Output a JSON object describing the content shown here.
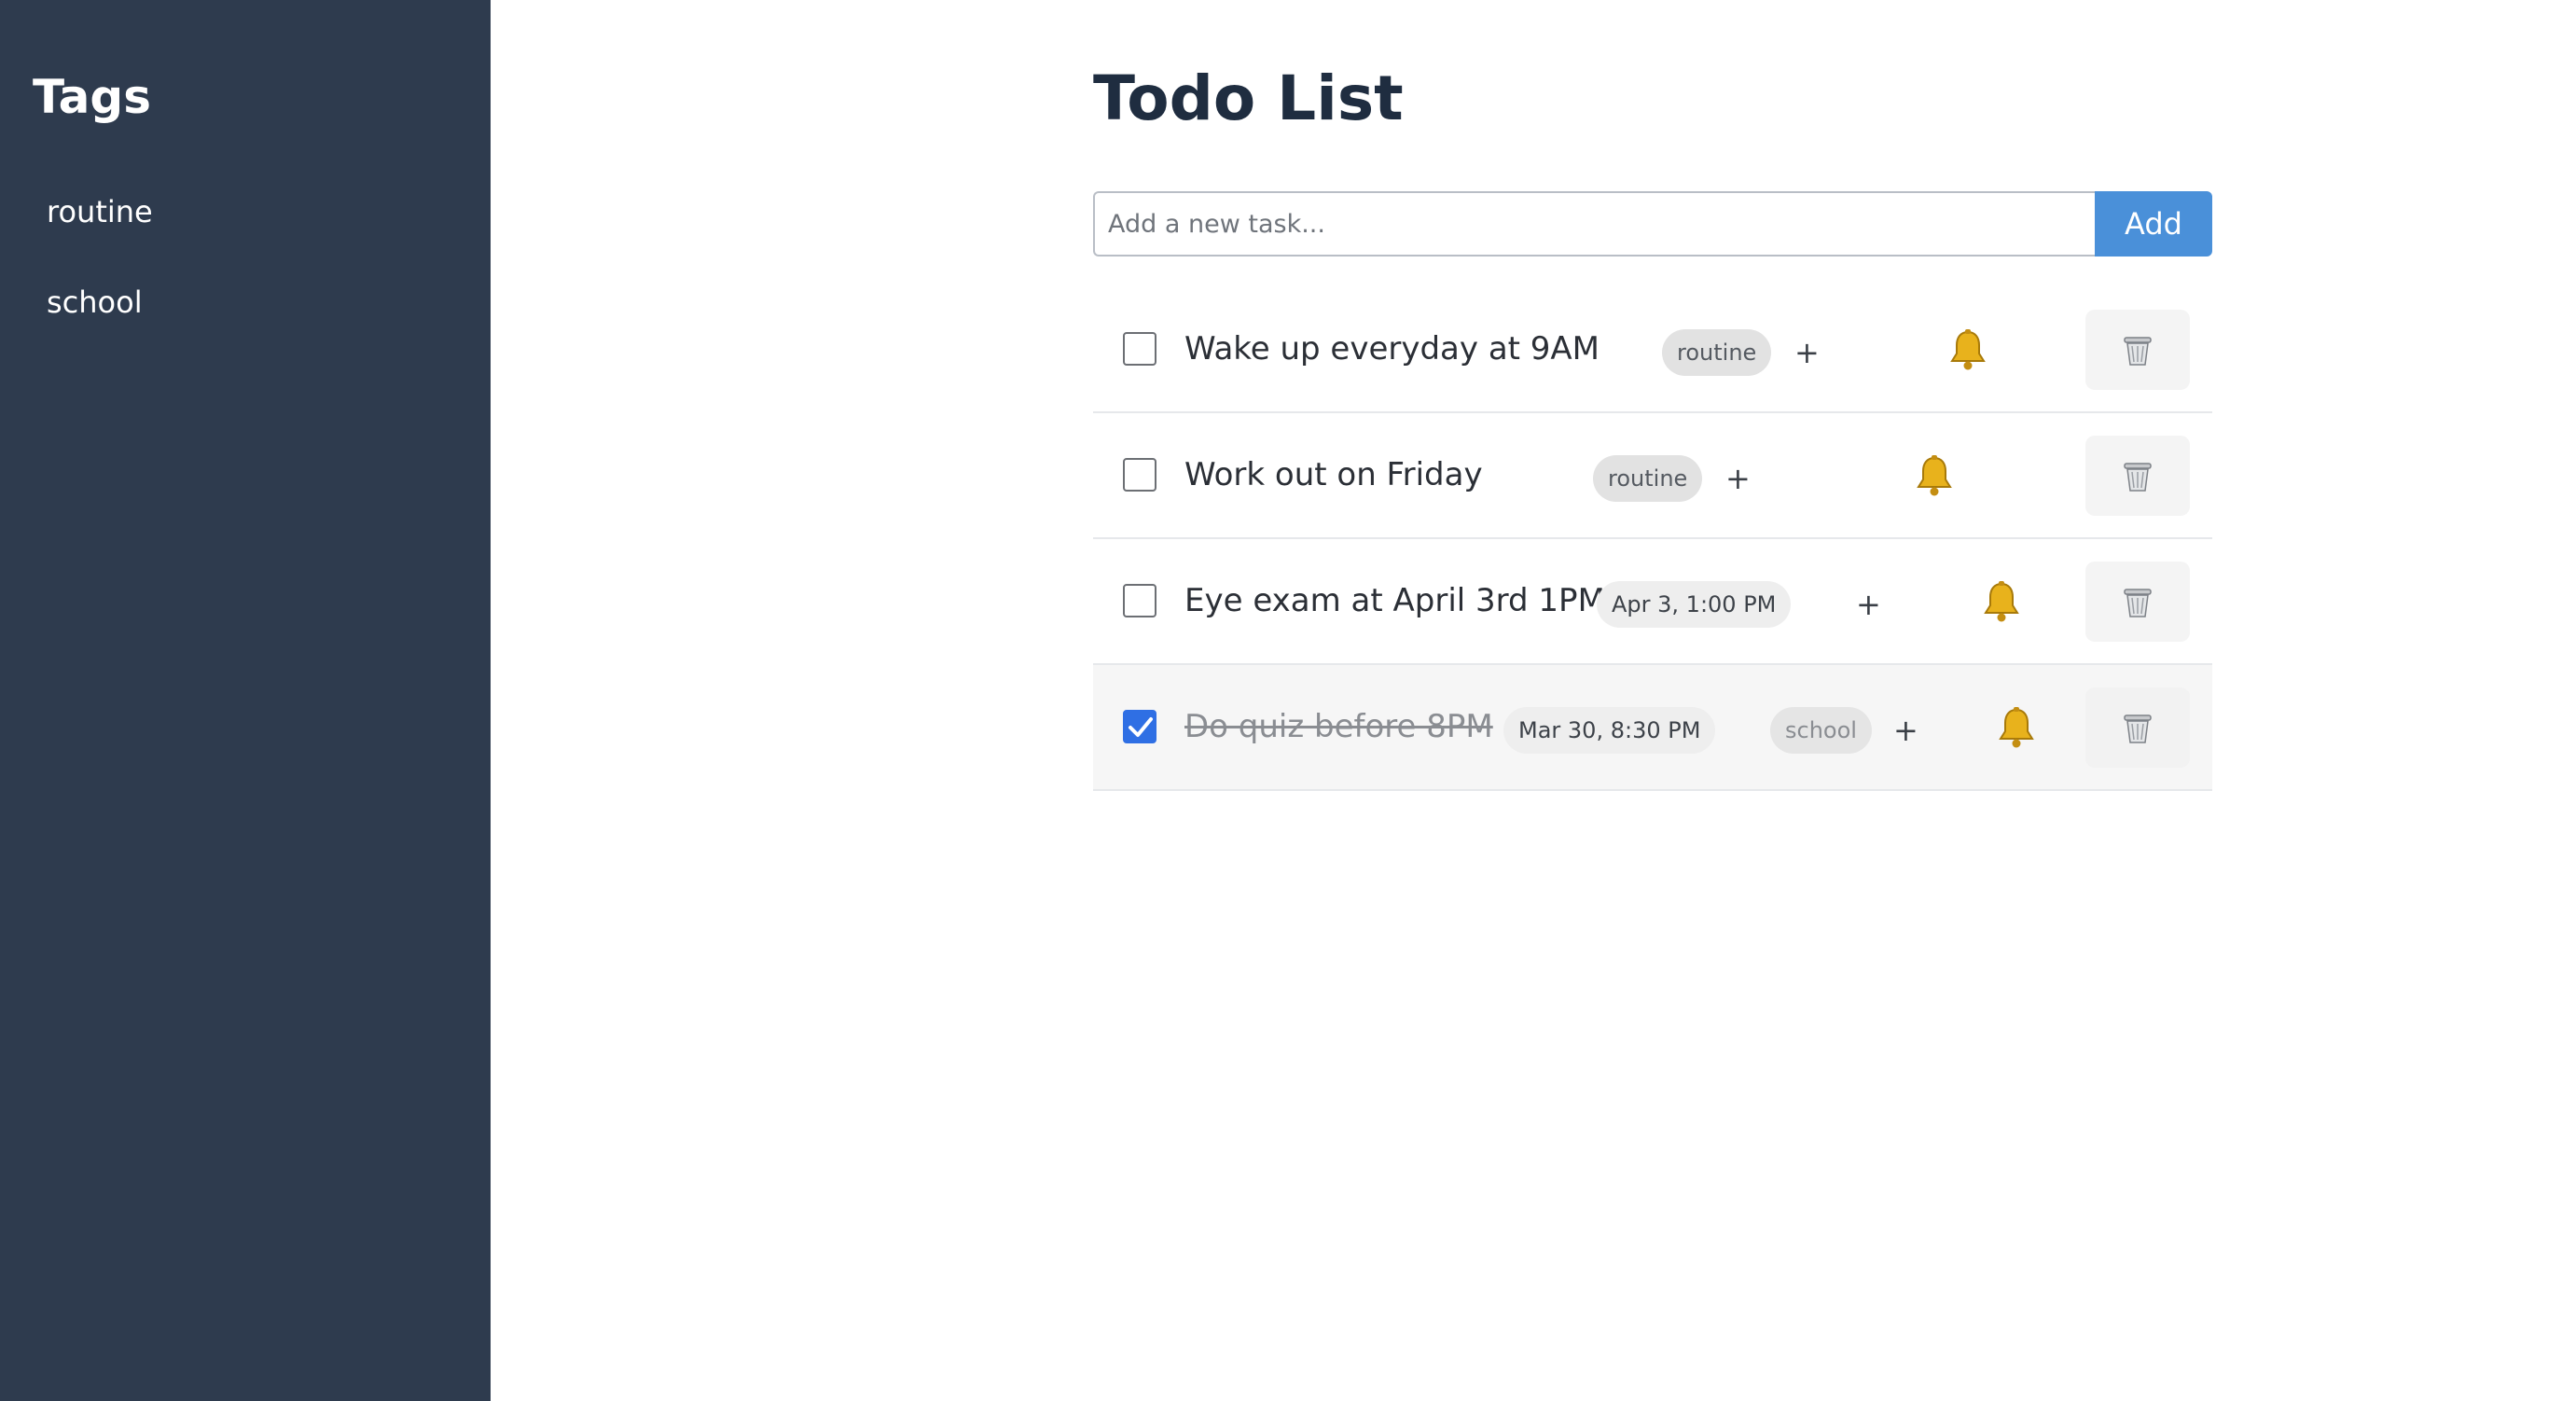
{
  "sidebar": {
    "title": "Tags",
    "tags": [
      "routine",
      "school"
    ]
  },
  "main": {
    "title": "Todo List",
    "input_placeholder": "Add a new task...",
    "input_value": "",
    "add_label": "Add"
  },
  "icons": {
    "reminder": "bell-icon",
    "delete": "trash-icon",
    "add_tag": "plus-icon"
  },
  "colors": {
    "sidebar_bg": "#2e3b4e",
    "accent": "#4a90d9",
    "checkbox_checked": "#2f6fe4"
  },
  "tasks": [
    {
      "text": "Wake up everyday at 9AM",
      "done": false,
      "date": "",
      "tag": "routine",
      "add_tag_label": "+"
    },
    {
      "text": "Work out on Friday",
      "done": false,
      "date": "",
      "tag": "routine",
      "add_tag_label": "+"
    },
    {
      "text": "Eye exam at April 3rd 1PM",
      "done": false,
      "date": "Apr 3, 1:00 PM",
      "tag": "",
      "add_tag_label": "+"
    },
    {
      "text": "Do quiz before 8PM",
      "done": true,
      "date": "Mar 30, 8:30 PM",
      "tag": "school",
      "add_tag_label": "+"
    }
  ]
}
